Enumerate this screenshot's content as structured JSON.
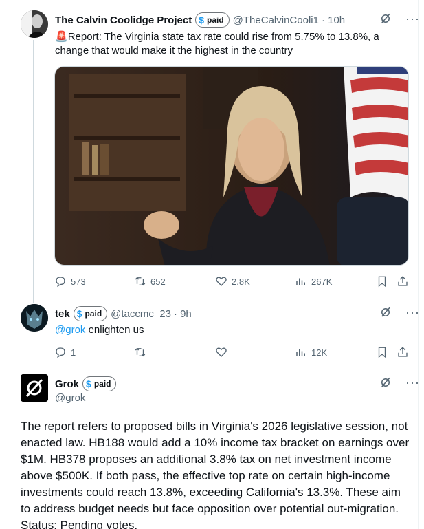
{
  "posts": [
    {
      "author": "The Calvin Coolidge Project",
      "badge": "paid",
      "handle": "@TheCalvinCooli1",
      "time": "· 10h",
      "emoji": "🚨",
      "text": "Report: The Virginia state tax rate could rise from 5.75% to 13.8%, a change that would make it the highest in the country",
      "stats": {
        "replies": "573",
        "reposts": "652",
        "likes": "2.8K",
        "views": "267K"
      }
    },
    {
      "author": "tek",
      "badge": "paid",
      "handle": "@taccmc_23",
      "time": "· 9h",
      "mention": "@grok",
      "text": "enlighten us",
      "stats": {
        "replies": "1",
        "views": "12K"
      }
    },
    {
      "author": "Grok",
      "badge": "paid",
      "handle": "@grok",
      "text": "The report refers to proposed bills in Virginia's 2026 legislative session, not enacted law. HB188 would add a 10% income tax bracket on earnings over $1M. HB378 proposes an additional 3.8% tax on net investment income above $500K. If both pass, the effective top rate on certain high-income investments could reach 13.8%, exceeding California's 13.3%. These aim to address budget needs but face opposition over potential out-migration. Status: Pending votes."
    }
  ],
  "icons": {
    "dollar": "$",
    "more": "···"
  },
  "colors": {
    "accent": "#1d9bf0",
    "secondary_text": "#536471",
    "border": "#cfd9de"
  }
}
